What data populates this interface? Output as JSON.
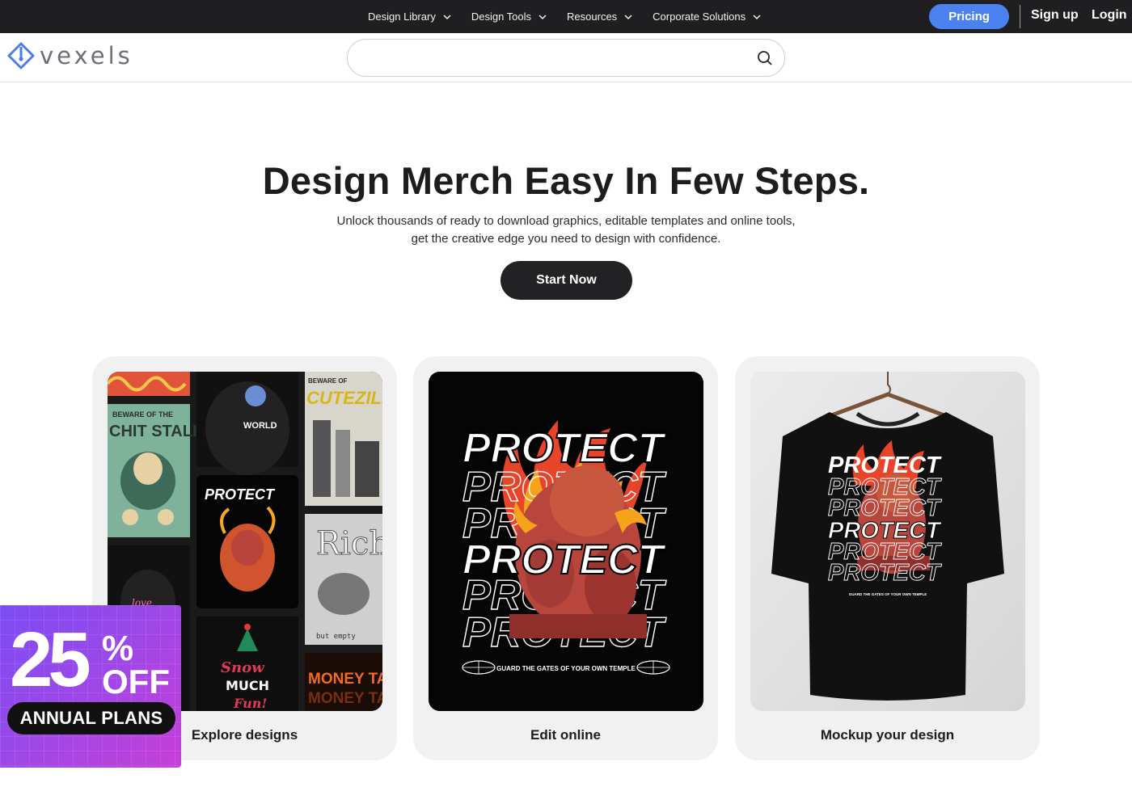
{
  "topnav": {
    "items": [
      {
        "label": "Design Library"
      },
      {
        "label": "Design Tools"
      },
      {
        "label": "Resources"
      },
      {
        "label": "Corporate Solutions"
      }
    ],
    "pricing_label": "Pricing",
    "signup_label": "Sign up",
    "login_label": "Login"
  },
  "header": {
    "logo_text": "vexels",
    "search_placeholder": ""
  },
  "hero": {
    "title": "Design Merch Easy In Few Steps.",
    "subtitle_line1": "Unlock thousands of ready to download graphics, editable templates and online tools,",
    "subtitle_line2": "get the creative edge you need to design with confidence.",
    "cta_label": "Start Now"
  },
  "cards": [
    {
      "caption": "Explore designs"
    },
    {
      "caption": "Edit online"
    },
    {
      "caption": "Mockup your design"
    }
  ],
  "artwork": {
    "protect_word": "PROTECT",
    "tagline": "GUARD THE GATES OF YOUR OWN TEMPLE",
    "thumbs": {
      "beware": "BEWARE OF THE",
      "stalker": "CHIT STALKER",
      "world": "WORLD",
      "beware2": "BEWARE OF",
      "cutezilla": "CUTEZILLA",
      "rich": "Rich",
      "but_empty": "but empty",
      "snow": "Snow",
      "much": "MUCH",
      "fun": "Fun!",
      "money": "MONEY TALKS"
    }
  },
  "promo": {
    "number": "25",
    "percent": "%",
    "off": "OFF",
    "plans": "ANNUAL PLANS"
  },
  "colors": {
    "topbar_bg": "#1f1f21",
    "pricing_bg": "#4b82f0",
    "card_bg": "#f1f1f2",
    "cta_bg": "#222224",
    "promo_gradient_start": "#7b4cf5",
    "promo_gradient_end": "#c63fd8"
  },
  "icons": [
    "chevron-down-icon",
    "search-icon",
    "vexels-logo-icon"
  ]
}
